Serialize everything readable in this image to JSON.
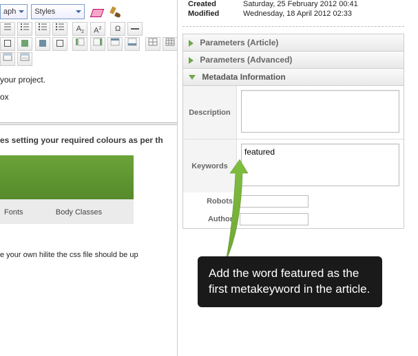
{
  "editor": {
    "paragraph_select": "aph",
    "styles_select": "Styles",
    "body_frag1": "your project.",
    "body_frag2": "ox",
    "section_title": "es setting your required colours as per th",
    "tabs": {
      "fonts": "Fonts",
      "body_classes": "Body Classes"
    },
    "note": "e your own hilite the css file should be up"
  },
  "meta_top": {
    "created_label": "Created",
    "created_value": "Saturday, 25 February 2012 00:41",
    "modified_label": "Modified",
    "modified_value": "Wednesday, 18 April 2012 02:33"
  },
  "accordions": {
    "params_article": "Parameters (Article)",
    "params_advanced": "Parameters (Advanced)",
    "metadata_info": "Metadata Information"
  },
  "metadata": {
    "description_label": "Description",
    "description_value": "",
    "keywords_label": "Keywords",
    "keywords_value": "featured",
    "robots_label": "Robots",
    "robots_value": "",
    "author_label": "Author",
    "author_value": ""
  },
  "callout": "Add the word featured as the first metakeyword in the article."
}
